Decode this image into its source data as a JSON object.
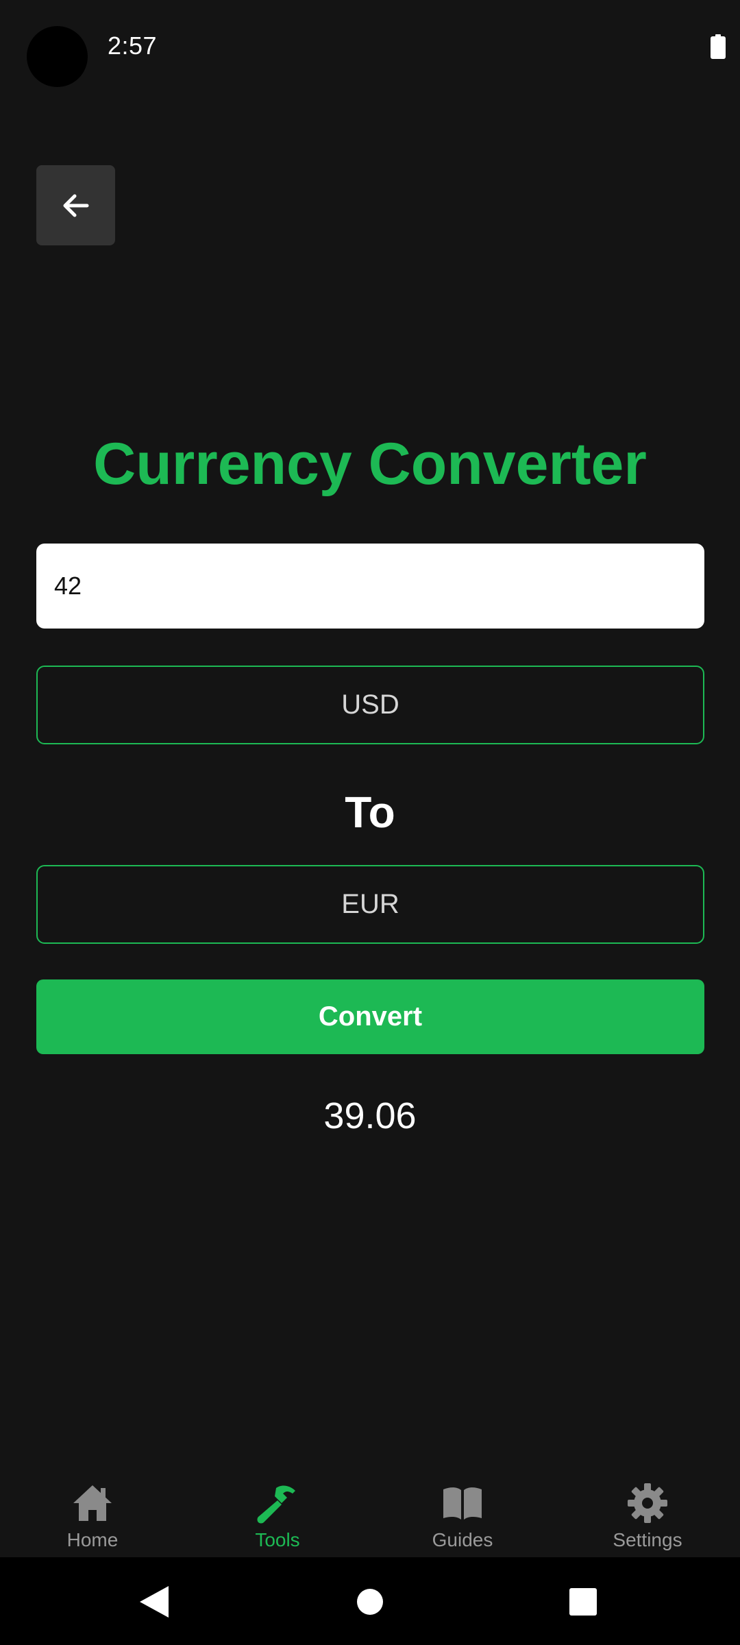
{
  "status_bar": {
    "time": "2:57",
    "battery_icon": "battery-full-icon"
  },
  "back_button": {
    "icon": "arrow-left-icon"
  },
  "title": "Currency Converter",
  "amount_input": {
    "value": "42"
  },
  "from_currency": {
    "value": "USD"
  },
  "to_label": "To",
  "to_currency": {
    "value": "EUR"
  },
  "convert_button": {
    "label": "Convert"
  },
  "result": "39.06",
  "bottom_nav": {
    "items": [
      {
        "label": "Home",
        "icon": "home-icon",
        "active": false
      },
      {
        "label": "Tools",
        "icon": "hammer-icon",
        "active": true
      },
      {
        "label": "Guides",
        "icon": "book-icon",
        "active": false
      },
      {
        "label": "Settings",
        "icon": "gear-icon",
        "active": false
      }
    ]
  },
  "system_nav": {
    "back_icon": "triangle-back-icon",
    "home_icon": "circle-home-icon",
    "recents_icon": "square-recents-icon"
  },
  "colors": {
    "accent": "#1db954",
    "background": "#141414",
    "inactive": "#9a9a9a"
  }
}
